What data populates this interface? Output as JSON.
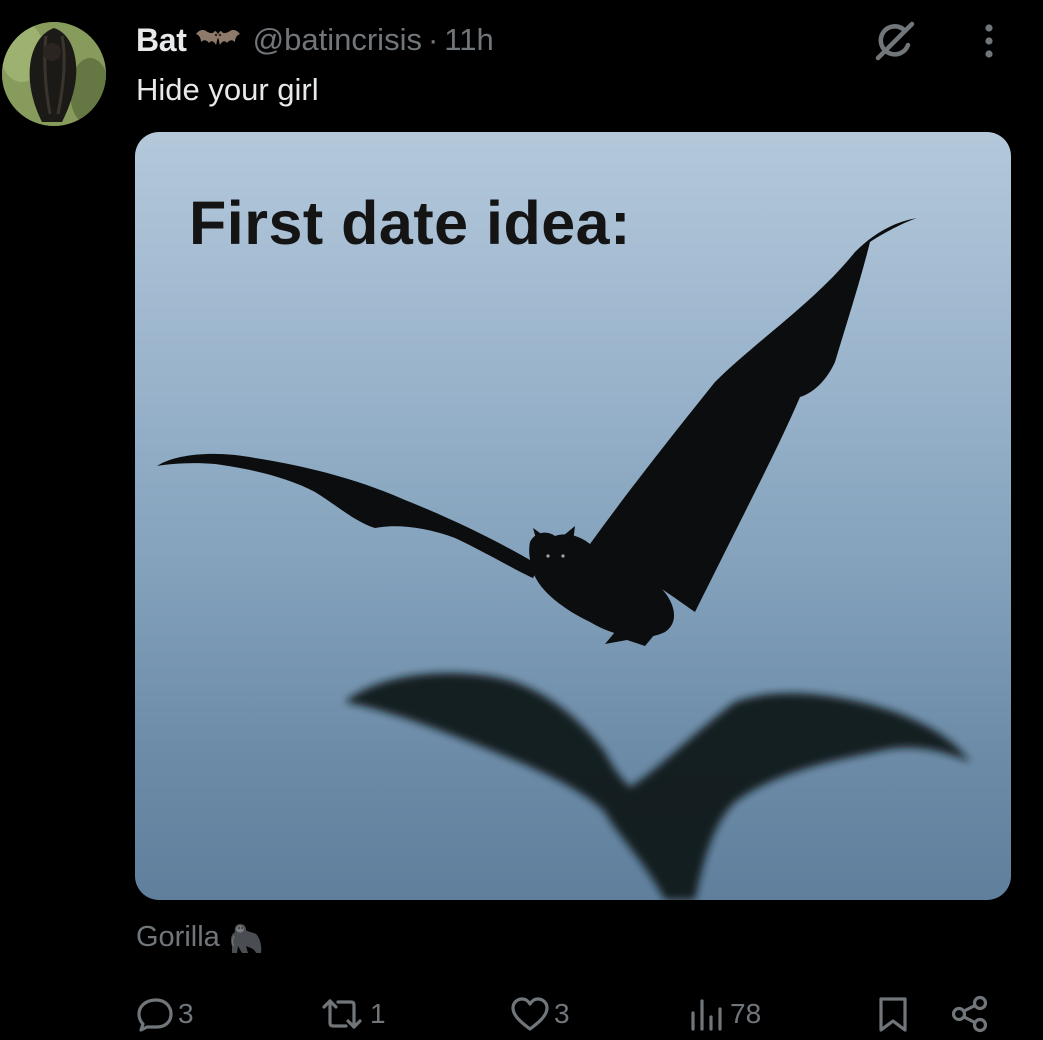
{
  "tweet": {
    "display_name": "Bat",
    "handle": "@batincrisis",
    "separator": "·",
    "timestamp": "11h",
    "text": "Hide your girl",
    "media": {
      "caption": "First date idea:"
    },
    "reply_context": "Gorilla"
  },
  "actions": {
    "replies": "3",
    "reposts": "1",
    "likes": "3",
    "views": "78"
  },
  "icons": {
    "grok": "grok-icon",
    "more": "more-vertical-icon",
    "reply": "speech-bubble-icon",
    "repost": "repost-arrows-icon",
    "like": "heart-icon",
    "views": "bar-chart-icon",
    "bookmark": "bookmark-icon",
    "share": "share-icon"
  },
  "colors": {
    "background": "#000000",
    "text_primary": "#e7e9ea",
    "text_secondary": "#71767b"
  }
}
